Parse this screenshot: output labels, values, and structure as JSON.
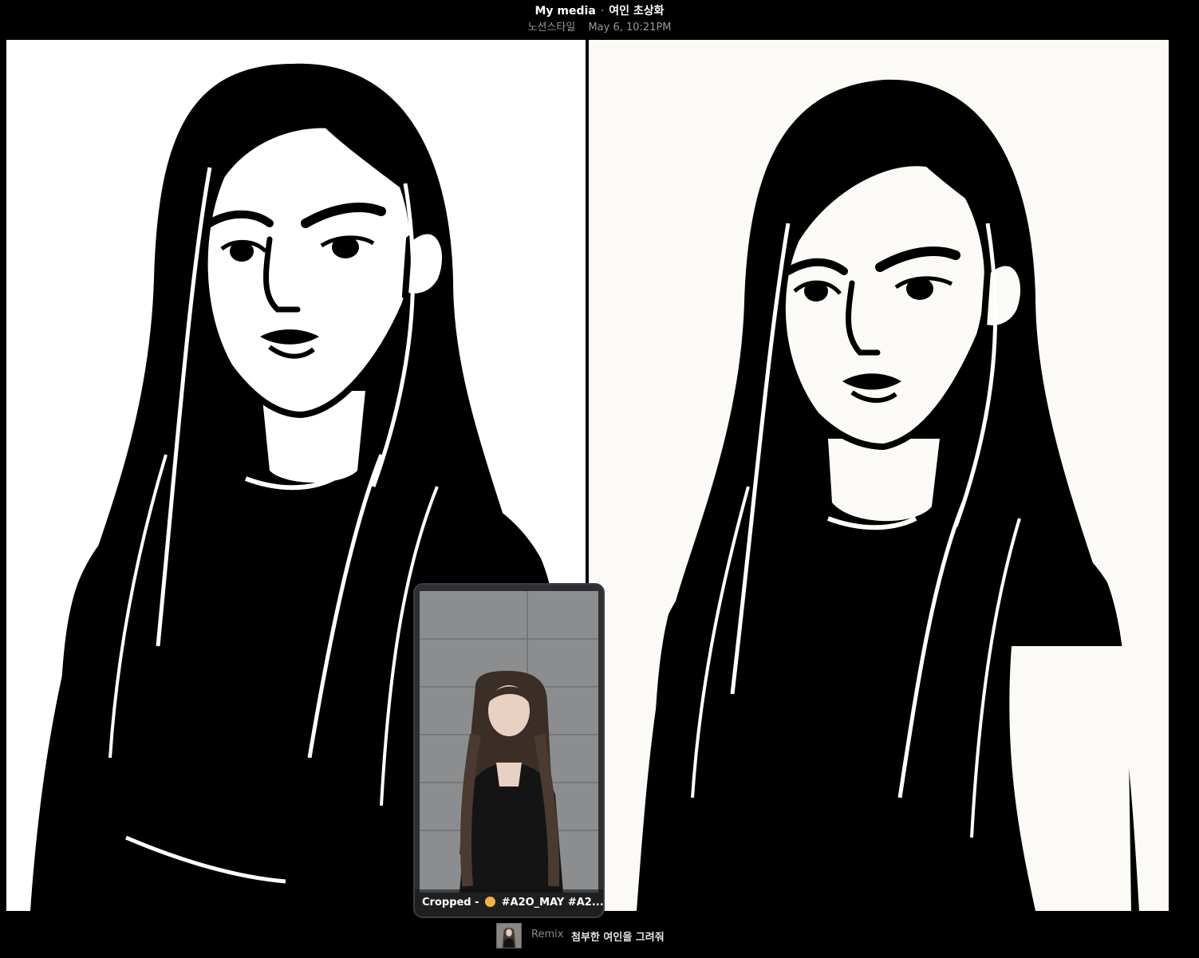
{
  "header": {
    "title": "My media",
    "separator": "·",
    "collection": "여인 초상화",
    "style_tag": "노션스타일",
    "timestamp": "May 6, 10:21PM"
  },
  "images": [
    {
      "label": "generated-image-1"
    },
    {
      "label": "generated-image-2"
    }
  ],
  "source_preview": {
    "caption_prefix": "Cropped -",
    "emoji": "hugging-face-emoji",
    "caption_tags": "#A2O_MAY #A2..."
  },
  "footer": {
    "remix_label": "Remix",
    "prompt": "첨부한 여인을 그려줘"
  },
  "colors": {
    "background": "#000000",
    "panel": "#ffffff",
    "pip_bg": "#2d2f33"
  }
}
